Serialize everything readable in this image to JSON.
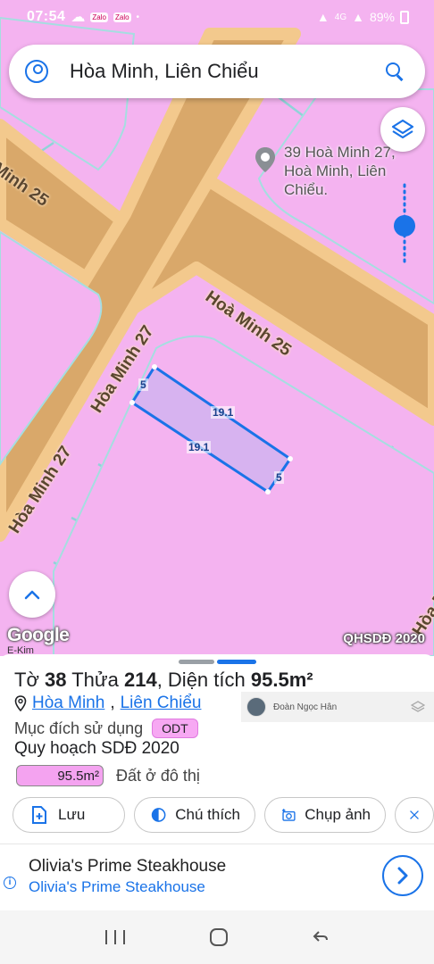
{
  "status_bar": {
    "time": "07:54",
    "mini_icons": [
      "Zalo",
      "Zalo"
    ],
    "dot": "•",
    "network": "4G",
    "battery": "89%"
  },
  "search": {
    "query": "Hòa Minh, Liên Chiểu"
  },
  "map": {
    "pin_label_line1": "39 Hoà Minh 27,",
    "pin_label_line2": "Hoà Minh, Liên Chiểu.",
    "road_labels": {
      "hoa_minh_25_top": "Minh 25",
      "hoa_minh_25_mid": "Hoà Minh 25",
      "hoa_minh_27_upper": "Hòa Minh 27",
      "hoa_minh_27_lower": "Hòa Minh 27",
      "hoa_minh_right": "Hòa M"
    },
    "parcel_dims": {
      "top": "19.1",
      "bottom": "19.1",
      "left": "5",
      "right": "5"
    },
    "google_logo": "Google",
    "attribution": "E-Kim",
    "layer_label": "QHSDĐ 2020",
    "colors": {
      "land": "#f4b3f0",
      "road": "#d9a86a",
      "parcel_outline": "#1a73e8",
      "grid": "#8fd3d8"
    }
  },
  "parcel": {
    "to_label": "Tờ",
    "to_value": "38",
    "thua_label": "Thửa",
    "thua_value": "214",
    "area_label": "Diện tích",
    "area_value": "95.5m²",
    "ward": "Hòa Minh",
    "district": "Liên Chiểu",
    "purpose_label": "Mục đích sử dụng",
    "purpose_code": "ODT",
    "plan_label": "Quy hoạch SDĐ 2020",
    "plan_area": "95.5m²",
    "plan_type": "Đất ở đô thị"
  },
  "user_overlay": {
    "name": "Đoàn Ngọc Hân"
  },
  "actions": {
    "save": "Lưu",
    "legend": "Chú thích",
    "capture": "Chụp ảnh"
  },
  "ad": {
    "title": "Olivia's Prime Steakhouse",
    "subtitle": "Olivia's Prime Steakhouse"
  }
}
